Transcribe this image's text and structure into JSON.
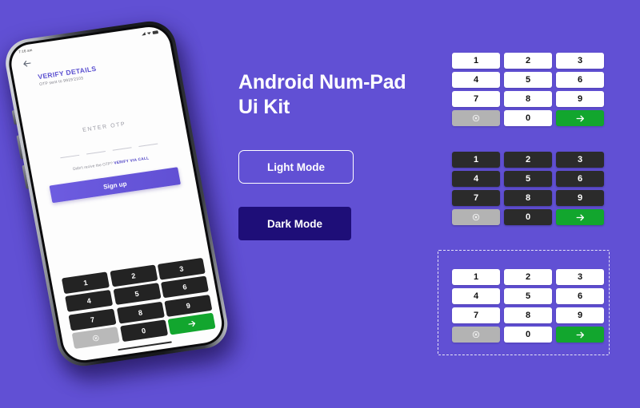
{
  "canvas": {
    "background_color": "#6150D4"
  },
  "headline": {
    "line1": "Android Num-Pad",
    "line2": "Ui Kit"
  },
  "mode_buttons": {
    "light": {
      "label": "Light Mode",
      "style": "outline",
      "border_color": "#FFFFFF"
    },
    "dark": {
      "label": "Dark Mode",
      "style": "filled",
      "fill_color": "#1E0E78"
    }
  },
  "phone": {
    "status_bar": {
      "left_text": "7:16 am"
    },
    "back_icon": "back-arrow-icon",
    "title": "VERIFY DETAILS",
    "subtitle": "OTP sent to 9919'2103",
    "otp_placeholder": "ENTER OTP",
    "otp_fields": 4,
    "resend_text": "Didn't recive the OTP?",
    "resend_action": "VERIFY VIA CALL",
    "primary_button": "Sign up",
    "title_color": "#5A4FD0",
    "primary_button_color": "#6150D4",
    "pad_theme": "dark"
  },
  "numpad_keys": {
    "row1": [
      "1",
      "2",
      "3"
    ],
    "row2": [
      "4",
      "5",
      "6"
    ],
    "row3": [
      "7",
      "8",
      "9"
    ],
    "delete_icon": "circle-x-delete-icon",
    "zero": "0",
    "submit_icon": "arrow-right-icon"
  },
  "numpads": [
    {
      "id": "numpad-light",
      "theme": "light",
      "key_bg": "#FFFFFF",
      "key_text": "#111111",
      "delete_bg": "#B3B3B3",
      "submit_bg": "#12A62E"
    },
    {
      "id": "numpad-dark",
      "theme": "dark",
      "key_bg": "#2B2B2B",
      "key_text": "#FFFFFF",
      "delete_bg": "#B3B3B3",
      "submit_bg": "#12A62E"
    },
    {
      "id": "numpad-dashed",
      "theme": "light",
      "key_bg": "#FFFFFF",
      "key_text": "#111111",
      "delete_bg": "#B3B3B3",
      "submit_bg": "#12A62E",
      "selection_border": "dashed"
    }
  ]
}
